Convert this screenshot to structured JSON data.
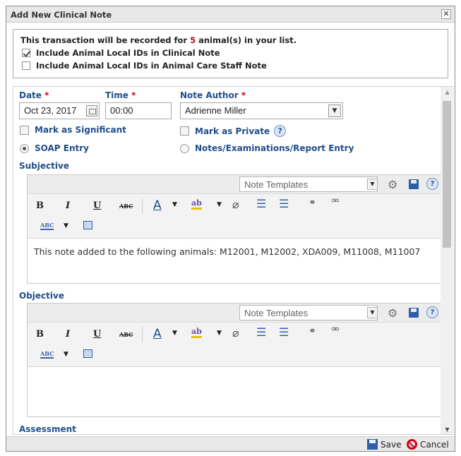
{
  "dialog": {
    "title": "Add New Clinical Note",
    "close_glyph": "✕"
  },
  "notice": {
    "text_before": "This transaction will be recorded for ",
    "animal_count": "5",
    "text_after": " animal(s) in your list.",
    "option1": {
      "label": "Include Animal Local IDs in Clinical Note",
      "checked": true
    },
    "option2": {
      "label": "Include Animal Local IDs in Animal Care Staff Note",
      "checked": false
    }
  },
  "form": {
    "date_label": "Date",
    "date_value": "Oct 23, 2017",
    "time_label": "Time",
    "time_value": "00:00",
    "author_label": "Note Author",
    "author_value": "Adrienne Miller",
    "required_mark": "*",
    "mark_significant": "Mark as Significant",
    "mark_private": "Mark as Private",
    "soap_entry": "SOAP Entry",
    "notes_entry": "Notes/Examinations/Report Entry",
    "entry_mode": "soap"
  },
  "sections": {
    "subjective": {
      "label": "Subjective",
      "template_placeholder": "Note Templates",
      "content": "This note added to the following animals: M12001, M12002, XDA009, M11008, M11007"
    },
    "objective": {
      "label": "Objective",
      "template_placeholder": "Note Templates",
      "content": ""
    },
    "assessment": {
      "label": "Assessment"
    }
  },
  "toolbar": {
    "bold": "B",
    "italic": "I",
    "underline": "U",
    "strike": "ABC",
    "font_color": "A",
    "highlight": "ab",
    "spell": "ABC"
  },
  "footer": {
    "save_label": "Save",
    "cancel_label": "Cancel"
  },
  "colors": {
    "label_blue": "#1f4e8c",
    "required_red": "#d0021b"
  }
}
